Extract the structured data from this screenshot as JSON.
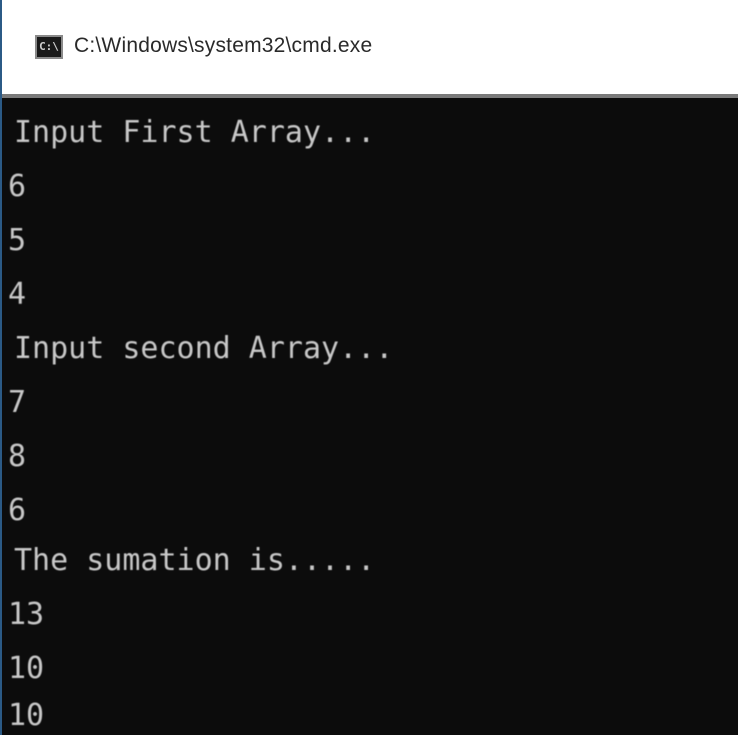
{
  "window": {
    "title": "C:\\Windows\\system32\\cmd.exe",
    "icon": "cmd-icon",
    "icon_glyph": "C:\\"
  },
  "console": {
    "lines": [
      "Input First Array...",
      "6",
      "5",
      "4",
      "Input second Array...",
      "7",
      "8",
      "6",
      "The sumation is.....",
      "13",
      "10",
      "10"
    ]
  },
  "colors": {
    "console_bg": "#0c0c0c",
    "console_text": "#c8c8c8",
    "titlebar_bg": "#ffffff"
  }
}
